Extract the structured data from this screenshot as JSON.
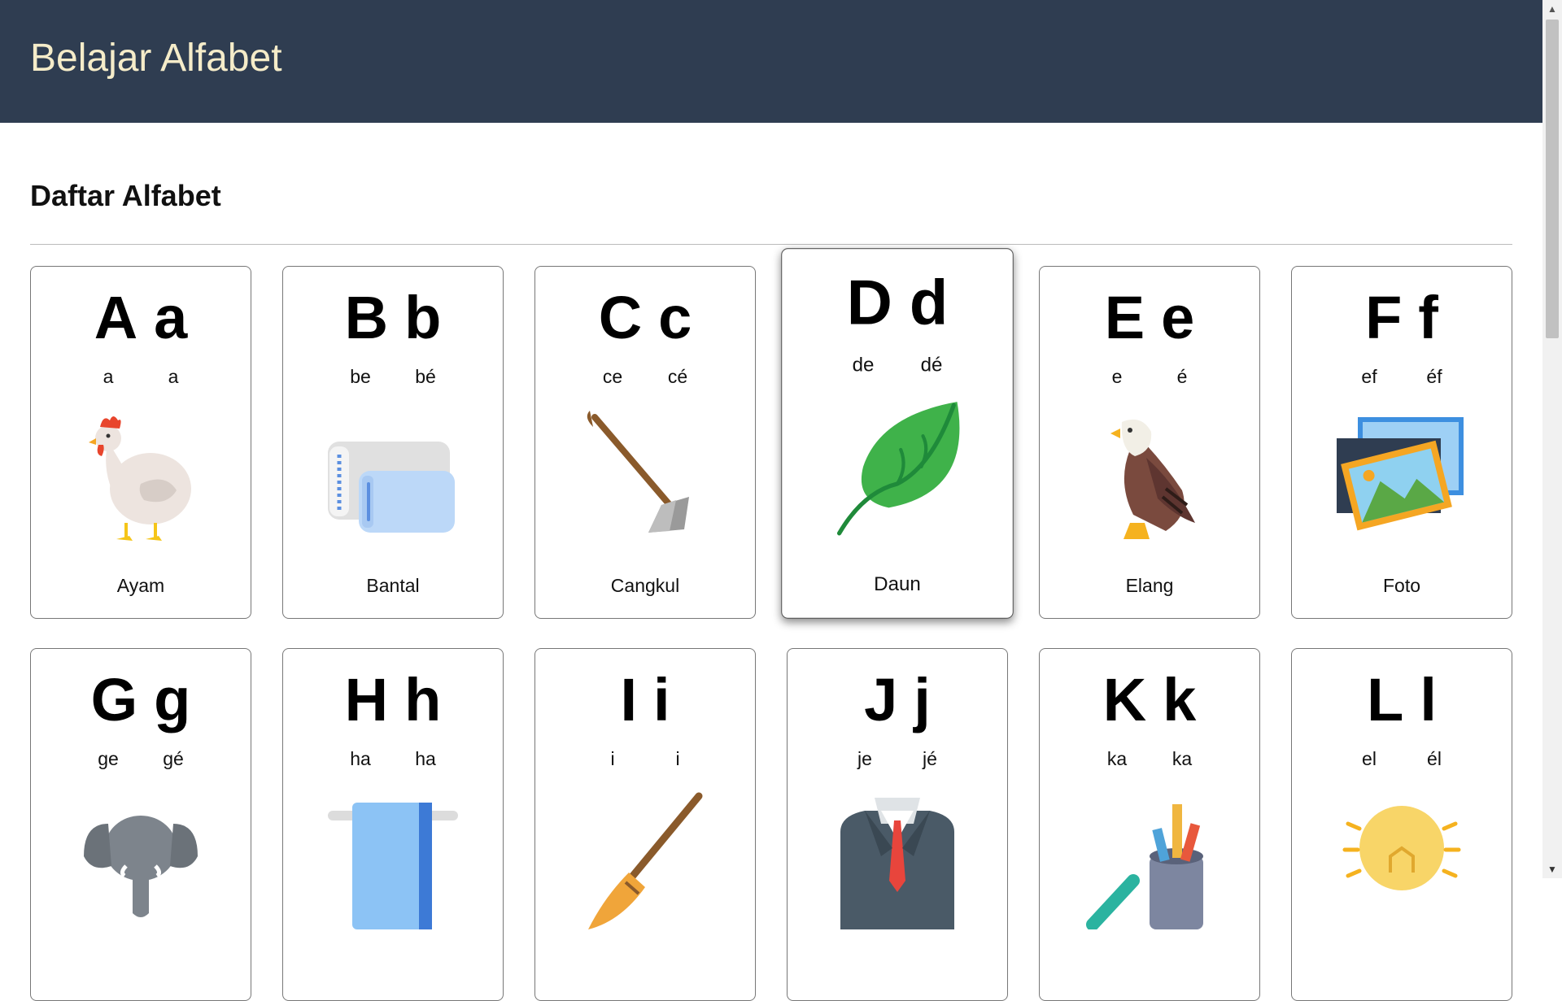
{
  "header": {
    "title": "Belajar Alfabet"
  },
  "section": {
    "title": "Daftar Alfabet"
  },
  "cards": [
    {
      "upper": "A",
      "lower": "a",
      "spell_upper": "a",
      "spell_lower": "a",
      "word": "Ayam",
      "icon": "chicken-icon"
    },
    {
      "upper": "B",
      "lower": "b",
      "spell_upper": "be",
      "spell_lower": "bé",
      "word": "Bantal",
      "icon": "pillow-icon"
    },
    {
      "upper": "C",
      "lower": "c",
      "spell_upper": "ce",
      "spell_lower": "cé",
      "word": "Cangkul",
      "icon": "hoe-icon"
    },
    {
      "upper": "D",
      "lower": "d",
      "spell_upper": "de",
      "spell_lower": "dé",
      "word": "Daun",
      "icon": "leaf-icon"
    },
    {
      "upper": "E",
      "lower": "e",
      "spell_upper": "e",
      "spell_lower": "é",
      "word": "Elang",
      "icon": "eagle-icon"
    },
    {
      "upper": "F",
      "lower": "f",
      "spell_upper": "ef",
      "spell_lower": "éf",
      "word": "Foto",
      "icon": "photo-icon"
    },
    {
      "upper": "G",
      "lower": "g",
      "spell_upper": "ge",
      "spell_lower": "gé",
      "word": "",
      "icon": "elephant-icon"
    },
    {
      "upper": "H",
      "lower": "h",
      "spell_upper": "ha",
      "spell_lower": "ha",
      "word": "",
      "icon": "towel-icon"
    },
    {
      "upper": "I",
      "lower": "i",
      "spell_upper": "i",
      "spell_lower": "i",
      "word": "",
      "icon": "broom-icon"
    },
    {
      "upper": "J",
      "lower": "j",
      "spell_upper": "je",
      "spell_lower": "jé",
      "word": "",
      "icon": "suit-icon"
    },
    {
      "upper": "K",
      "lower": "k",
      "spell_upper": "ka",
      "spell_lower": "ka",
      "word": "",
      "icon": "crayons-icon"
    },
    {
      "upper": "L",
      "lower": "l",
      "spell_upper": "el",
      "spell_lower": "él",
      "word": "",
      "icon": "lightbulb-icon"
    }
  ],
  "colors": {
    "header_bg": "#2f3d51",
    "title_text": "#f5ecc9",
    "card_border": "#777777"
  }
}
